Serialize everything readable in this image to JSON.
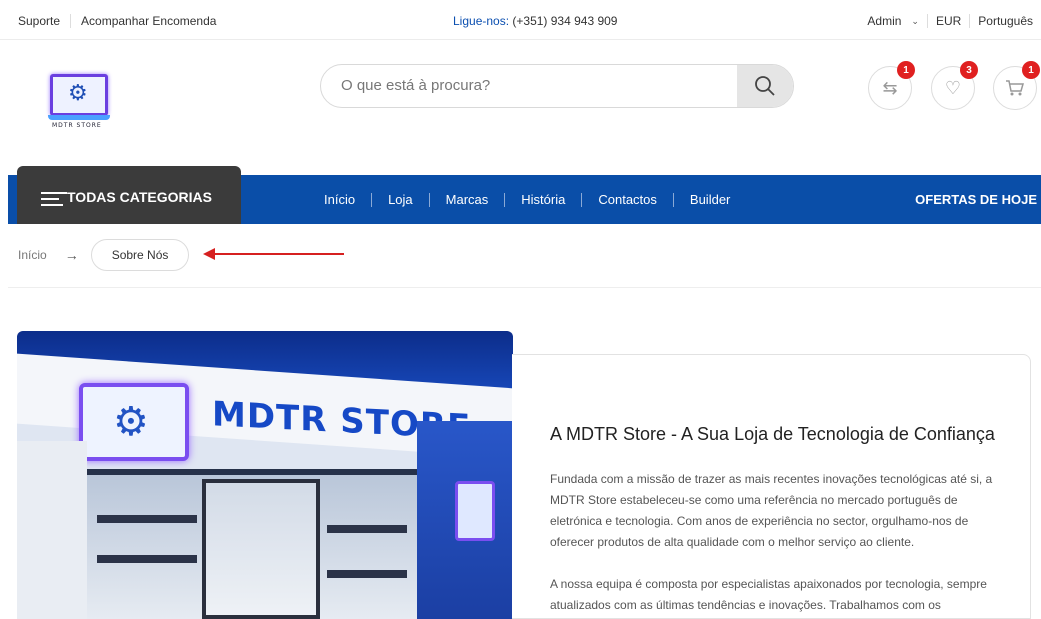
{
  "topbar": {
    "support": "Suporte",
    "track_order": "Acompanhar Encomenda",
    "phone_label": "Ligue-nos:",
    "phone_number": "(+351) 934 943 909",
    "account": "Admin",
    "currency": "EUR",
    "language": "Português"
  },
  "header": {
    "logo_text": "MDTR STORE",
    "search_placeholder": "O que está à procura?",
    "compare_count": "1",
    "wishlist_count": "3",
    "cart_count": "1"
  },
  "nav": {
    "all_categories": "TODAS CATEGORIAS",
    "items": [
      "Início",
      "Loja",
      "Marcas",
      "História",
      "Contactos",
      "Builder"
    ],
    "deals": "OFERTAS DE HOJE"
  },
  "breadcrumb": {
    "home": "Início",
    "arrow": "→",
    "current": "Sobre Nós"
  },
  "store_image": {
    "sign_text": "MDTR STORE"
  },
  "about": {
    "title": "A MDTR Store - A Sua Loja de Tecnologia de Confiança",
    "paragraph1": "Fundada com a missão de trazer as mais recentes inovações tecnológicas até si, a MDTR Store estabeleceu-se como uma referência no mercado português de eletrónica e tecnologia. Com anos de experiência no sector, orgulhamo-nos de oferecer produtos de alta qualidade com o melhor serviço ao cliente.",
    "paragraph2": "A nossa equipa é composta por especialistas apaixonados por tecnologia, sempre atualizados com as últimas tendências e inovações. Trabalhamos com os"
  },
  "colors": {
    "nav_blue": "#0a4ea8",
    "category_tab": "#3b3b3b",
    "badge_red": "#e02020",
    "annotation_arrow": "#d62020"
  }
}
